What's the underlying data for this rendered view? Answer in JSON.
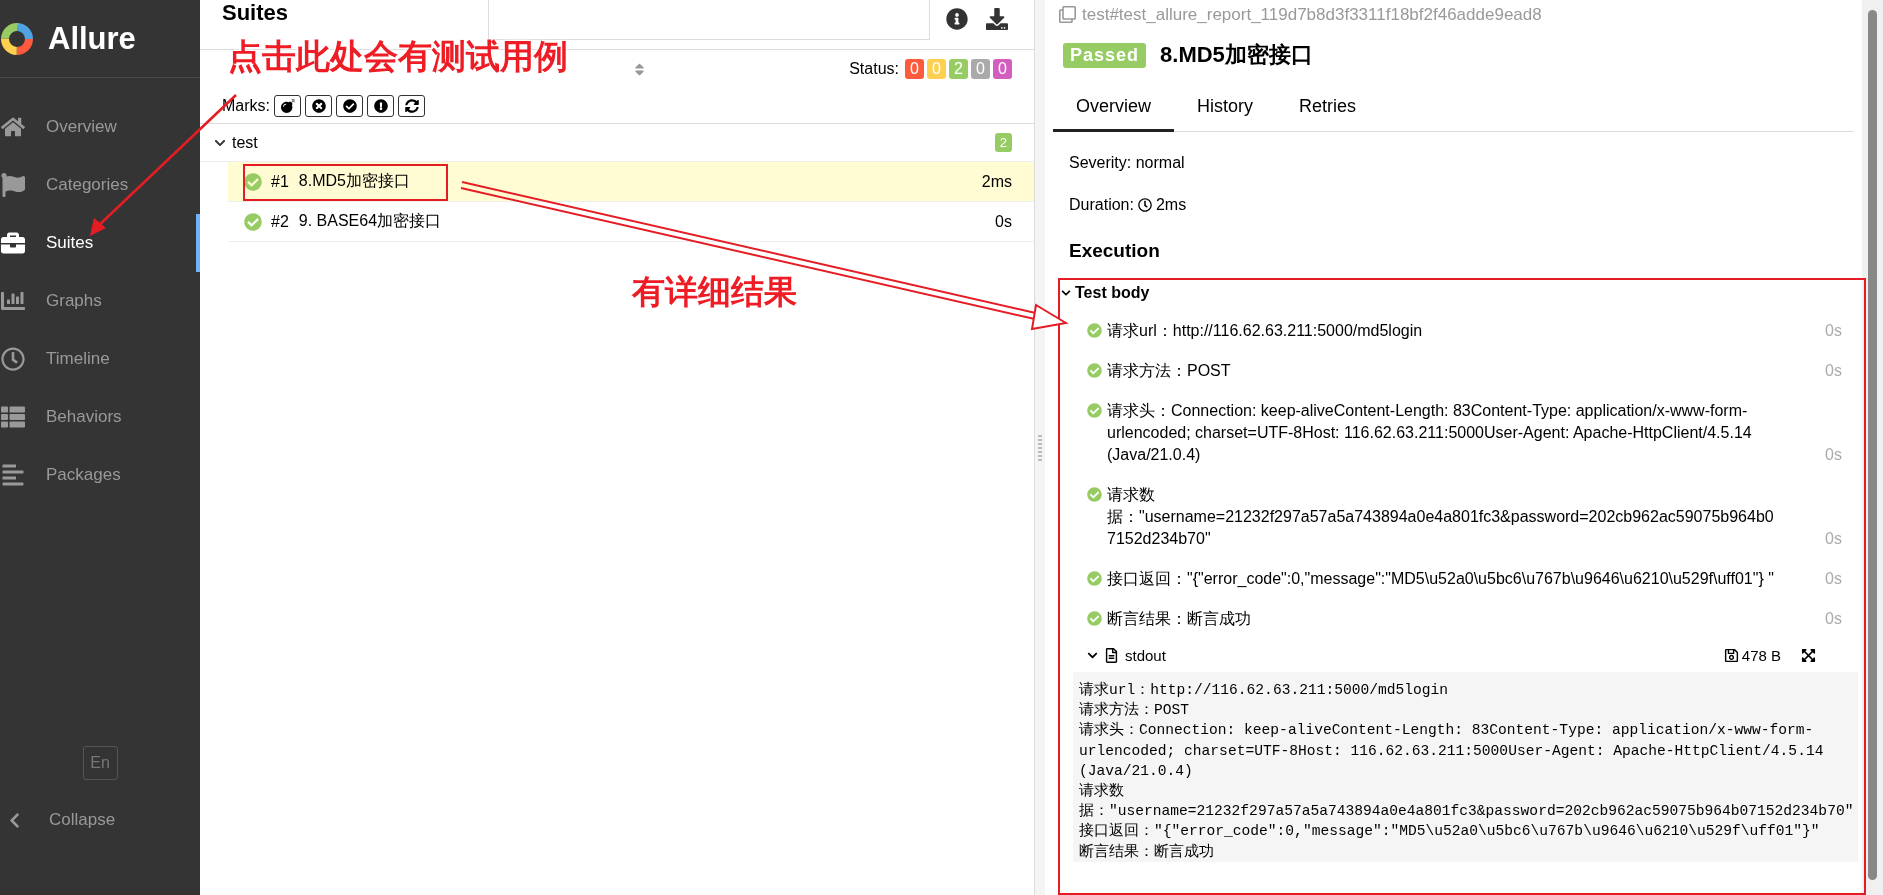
{
  "sidebar": {
    "logo_text": "Allure",
    "items": [
      {
        "label": "Overview",
        "selected": false
      },
      {
        "label": "Categories",
        "selected": false
      },
      {
        "label": "Suites",
        "selected": true
      },
      {
        "label": "Graphs",
        "selected": false
      },
      {
        "label": "Timeline",
        "selected": false
      },
      {
        "label": "Behaviors",
        "selected": false
      },
      {
        "label": "Packages",
        "selected": false
      }
    ],
    "language": "En",
    "collapse": "Collapse"
  },
  "suites_panel": {
    "title": "Suites",
    "status_label": "Status:",
    "status_counts": [
      {
        "count": "0",
        "color": "#fd5a3e"
      },
      {
        "count": "0",
        "color": "#ffd050"
      },
      {
        "count": "2",
        "color": "#97cc64"
      },
      {
        "count": "0",
        "color": "#aaaaaa"
      },
      {
        "count": "0",
        "color": "#d35ebe"
      }
    ],
    "marks_label": "Marks:",
    "tree": {
      "name": "test",
      "count": "2",
      "expanded": true,
      "children": [
        {
          "number": "#1",
          "name": "8.MD5加密接口",
          "duration": "2ms",
          "selected": true
        },
        {
          "number": "#2",
          "name": "9. BASE64加密接口",
          "duration": "0s",
          "selected": false
        }
      ]
    }
  },
  "detail": {
    "test_id": "test#test_allure_report_119d7b8d3f3311f18bf2f46adde9ead8",
    "status": "Passed",
    "title": "8.MD5加密接口",
    "tabs": [
      {
        "label": "Overview",
        "selected": true
      },
      {
        "label": "History",
        "selected": false
      },
      {
        "label": "Retries",
        "selected": false
      }
    ],
    "severity": "Severity: normal",
    "duration_label": "Duration:",
    "duration": "2ms",
    "section": "Execution",
    "test_body": {
      "title": "Test body",
      "expanded": true,
      "steps": [
        {
          "text": "请求url：http://116.62.63.211:5000/md5login",
          "duration": "0s"
        },
        {
          "text": "请求方法：POST",
          "duration": "0s"
        },
        {
          "text": "请求头：Connection: keep-aliveContent-Length: 83Content-Type: application/x-www-form-urlencoded; charset=UTF-8Host: 116.62.63.211:5000User-Agent: Apache-HttpClient/4.5.14 (Java/21.0.4)",
          "duration": "0s"
        },
        {
          "text": "请求数据：\"username=21232f297a57a5a743894a0e4a801fc3&password=202cb962ac59075b964b07152d234b70\"",
          "duration": "0s"
        },
        {
          "text": "接口返回：\"{\"error_code\":0,\"message\":\"MD5\\u52a0\\u5bc6\\u767b\\u9646\\u6210\\u529f\\uff01\"} \"",
          "duration": "0s"
        },
        {
          "text": "断言结果：断言成功",
          "duration": "0s"
        }
      ],
      "attachment": {
        "name": "stdout",
        "size": "478 B",
        "expanded": true,
        "lines": [
          "请求url：http://116.62.63.211:5000/md5login",
          "请求方法：POST",
          "请求头：Connection: keep-aliveContent-Length: 83Content-Type: application/x-www-form-urlencoded; charset=UTF-8Host: 116.62.63.211:5000User-Agent: Apache-HttpClient/4.5.14 (Java/21.0.4)",
          "请求数据：\"username=21232f297a57a5a743894a0e4a801fc3&password=202cb962ac59075b964b07152d234b70\"",
          "接口返回：\"{\"error_code\":0,\"message\":\"MD5\\u52a0\\u5bc6\\u767b\\u9646\\u6210\\u529f\\uff01\"}\"",
          "断言结果：断言成功"
        ]
      }
    }
  },
  "annotations": [
    {
      "text": "点击此处会有测试用例"
    },
    {
      "text": "有详细结果"
    }
  ]
}
